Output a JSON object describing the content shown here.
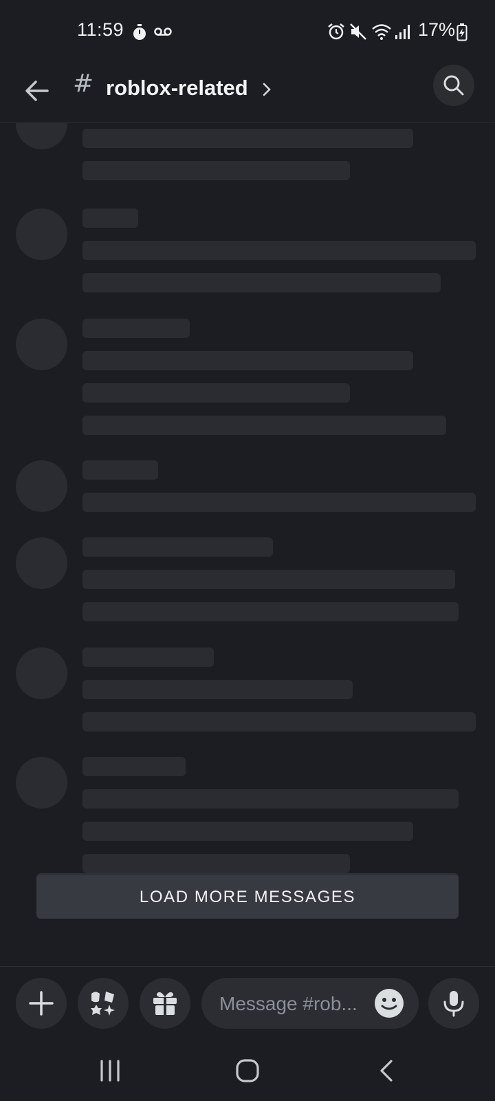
{
  "status_bar": {
    "time": "11:59",
    "battery": "17%",
    "icons": [
      "stopwatch-icon",
      "voicemail-icon",
      "alarm-icon",
      "mute-icon",
      "wifi-icon",
      "signal-icon",
      "battery-charging-icon"
    ]
  },
  "header": {
    "channel_prefix": "#",
    "channel_name": "roblox-related",
    "back_icon": "arrow-left-icon",
    "search_icon": "search-icon"
  },
  "load_more": {
    "label": "LOAD MORE MESSAGES"
  },
  "composer": {
    "placeholder": "Message #rob...",
    "buttons": [
      "plus-icon",
      "apps-icon",
      "gift-icon",
      "emoji-icon",
      "microphone-icon"
    ]
  },
  "nav_bar": {
    "buttons": [
      "recent-apps-icon",
      "home-icon",
      "back-icon"
    ]
  },
  "colors": {
    "background": "#1c1d22",
    "skeleton": "#2b2c32",
    "button": "#383a42",
    "text": "#f2f3f5"
  }
}
